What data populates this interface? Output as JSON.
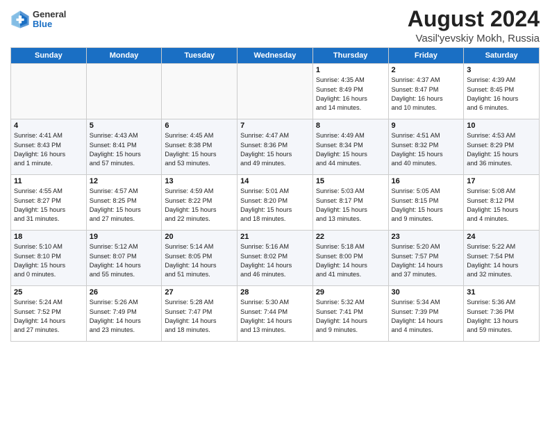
{
  "header": {
    "logo_general": "General",
    "logo_blue": "Blue",
    "month_year": "August 2024",
    "location": "Vasil'yevskiy Mokh, Russia"
  },
  "days_of_week": [
    "Sunday",
    "Monday",
    "Tuesday",
    "Wednesday",
    "Thursday",
    "Friday",
    "Saturday"
  ],
  "weeks": [
    [
      {
        "day": "",
        "info": ""
      },
      {
        "day": "",
        "info": ""
      },
      {
        "day": "",
        "info": ""
      },
      {
        "day": "",
        "info": ""
      },
      {
        "day": "1",
        "info": "Sunrise: 4:35 AM\nSunset: 8:49 PM\nDaylight: 16 hours\nand 14 minutes."
      },
      {
        "day": "2",
        "info": "Sunrise: 4:37 AM\nSunset: 8:47 PM\nDaylight: 16 hours\nand 10 minutes."
      },
      {
        "day": "3",
        "info": "Sunrise: 4:39 AM\nSunset: 8:45 PM\nDaylight: 16 hours\nand 6 minutes."
      }
    ],
    [
      {
        "day": "4",
        "info": "Sunrise: 4:41 AM\nSunset: 8:43 PM\nDaylight: 16 hours\nand 1 minute."
      },
      {
        "day": "5",
        "info": "Sunrise: 4:43 AM\nSunset: 8:41 PM\nDaylight: 15 hours\nand 57 minutes."
      },
      {
        "day": "6",
        "info": "Sunrise: 4:45 AM\nSunset: 8:38 PM\nDaylight: 15 hours\nand 53 minutes."
      },
      {
        "day": "7",
        "info": "Sunrise: 4:47 AM\nSunset: 8:36 PM\nDaylight: 15 hours\nand 49 minutes."
      },
      {
        "day": "8",
        "info": "Sunrise: 4:49 AM\nSunset: 8:34 PM\nDaylight: 15 hours\nand 44 minutes."
      },
      {
        "day": "9",
        "info": "Sunrise: 4:51 AM\nSunset: 8:32 PM\nDaylight: 15 hours\nand 40 minutes."
      },
      {
        "day": "10",
        "info": "Sunrise: 4:53 AM\nSunset: 8:29 PM\nDaylight: 15 hours\nand 36 minutes."
      }
    ],
    [
      {
        "day": "11",
        "info": "Sunrise: 4:55 AM\nSunset: 8:27 PM\nDaylight: 15 hours\nand 31 minutes."
      },
      {
        "day": "12",
        "info": "Sunrise: 4:57 AM\nSunset: 8:25 PM\nDaylight: 15 hours\nand 27 minutes."
      },
      {
        "day": "13",
        "info": "Sunrise: 4:59 AM\nSunset: 8:22 PM\nDaylight: 15 hours\nand 22 minutes."
      },
      {
        "day": "14",
        "info": "Sunrise: 5:01 AM\nSunset: 8:20 PM\nDaylight: 15 hours\nand 18 minutes."
      },
      {
        "day": "15",
        "info": "Sunrise: 5:03 AM\nSunset: 8:17 PM\nDaylight: 15 hours\nand 13 minutes."
      },
      {
        "day": "16",
        "info": "Sunrise: 5:05 AM\nSunset: 8:15 PM\nDaylight: 15 hours\nand 9 minutes."
      },
      {
        "day": "17",
        "info": "Sunrise: 5:08 AM\nSunset: 8:12 PM\nDaylight: 15 hours\nand 4 minutes."
      }
    ],
    [
      {
        "day": "18",
        "info": "Sunrise: 5:10 AM\nSunset: 8:10 PM\nDaylight: 15 hours\nand 0 minutes."
      },
      {
        "day": "19",
        "info": "Sunrise: 5:12 AM\nSunset: 8:07 PM\nDaylight: 14 hours\nand 55 minutes."
      },
      {
        "day": "20",
        "info": "Sunrise: 5:14 AM\nSunset: 8:05 PM\nDaylight: 14 hours\nand 51 minutes."
      },
      {
        "day": "21",
        "info": "Sunrise: 5:16 AM\nSunset: 8:02 PM\nDaylight: 14 hours\nand 46 minutes."
      },
      {
        "day": "22",
        "info": "Sunrise: 5:18 AM\nSunset: 8:00 PM\nDaylight: 14 hours\nand 41 minutes."
      },
      {
        "day": "23",
        "info": "Sunrise: 5:20 AM\nSunset: 7:57 PM\nDaylight: 14 hours\nand 37 minutes."
      },
      {
        "day": "24",
        "info": "Sunrise: 5:22 AM\nSunset: 7:54 PM\nDaylight: 14 hours\nand 32 minutes."
      }
    ],
    [
      {
        "day": "25",
        "info": "Sunrise: 5:24 AM\nSunset: 7:52 PM\nDaylight: 14 hours\nand 27 minutes."
      },
      {
        "day": "26",
        "info": "Sunrise: 5:26 AM\nSunset: 7:49 PM\nDaylight: 14 hours\nand 23 minutes."
      },
      {
        "day": "27",
        "info": "Sunrise: 5:28 AM\nSunset: 7:47 PM\nDaylight: 14 hours\nand 18 minutes."
      },
      {
        "day": "28",
        "info": "Sunrise: 5:30 AM\nSunset: 7:44 PM\nDaylight: 14 hours\nand 13 minutes."
      },
      {
        "day": "29",
        "info": "Sunrise: 5:32 AM\nSunset: 7:41 PM\nDaylight: 14 hours\nand 9 minutes."
      },
      {
        "day": "30",
        "info": "Sunrise: 5:34 AM\nSunset: 7:39 PM\nDaylight: 14 hours\nand 4 minutes."
      },
      {
        "day": "31",
        "info": "Sunrise: 5:36 AM\nSunset: 7:36 PM\nDaylight: 13 hours\nand 59 minutes."
      }
    ]
  ]
}
